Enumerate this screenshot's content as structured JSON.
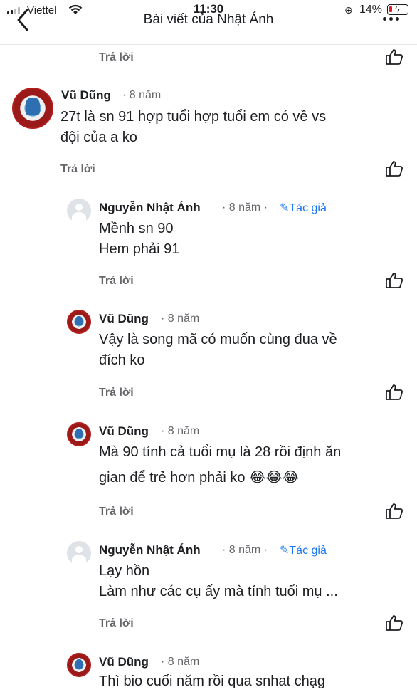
{
  "status": {
    "carrier": "Viettel",
    "time": "11:30",
    "battery": "14%"
  },
  "header": {
    "title": "Bài viết của Nhật Ánh"
  },
  "reply_label": "Trả lời",
  "author_badge": "Tác giả",
  "comments": [
    {
      "name": "Vũ Dũng",
      "time": "· 8 năm",
      "lines": [
        "27t là sn 91 hợp tuổi hợp tuổi em có  về vs",
        "đội của a ko"
      ]
    },
    {
      "name": "Nguyễn Nhật Ánh",
      "time": "· 8 năm ·",
      "lines": [
        "Mềnh sn 90",
        "Hem phải 91"
      ]
    },
    {
      "name": "Vũ Dũng",
      "time": "· 8 năm",
      "lines": [
        "Vậy là song mã có muốn cùng đua về",
        "đích ko"
      ]
    },
    {
      "name": "Vũ Dũng",
      "time": "· 8 năm",
      "lines": [
        "Mà 90 tính cả tuổi mụ là 28 rồi định ăn",
        "gian để trẻ hơn phải ko"
      ],
      "emoji": "😂😂😂"
    },
    {
      "name": "Nguyễn Nhật Ánh",
      "time": "· 8 năm ·",
      "lines": [
        "Lạy hồn",
        "Làm như các cụ ấy mà tính tuổi mụ ..."
      ]
    },
    {
      "name": "Vũ Dũng",
      "time": "· 8 năm",
      "lines": [
        "Thì bio cuối năm rồi qua snhat chạg"
      ]
    }
  ]
}
